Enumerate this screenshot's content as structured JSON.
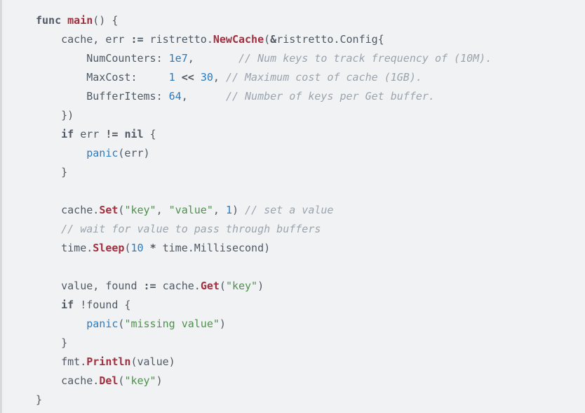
{
  "code": {
    "l1_func": "func",
    "l1_main": "main",
    "l1_rest": "() {",
    "l2a": "    cache, err ",
    "l2op": ":=",
    "l2b": " ristretto.",
    "l2fn": "NewCache",
    "l2c": "(",
    "l2amp": "&",
    "l2d": "ristretto.Config{",
    "l3a": "        NumCounters: ",
    "l3num": "1e7",
    "l3b": ",       ",
    "l3c": "// Num keys to track frequency of (10M).",
    "l4a": "        MaxCost:     ",
    "l4n1": "1",
    "l4sp1": " ",
    "l4op": "<<",
    "l4sp2": " ",
    "l4n2": "30",
    "l4b": ", ",
    "l4c": "// Maximum cost of cache (1GB).",
    "l5a": "        BufferItems: ",
    "l5num": "64",
    "l5b": ",      ",
    "l5c": "// Number of keys per Get buffer.",
    "l6": "    })",
    "l7a": "    ",
    "l7if": "if",
    "l7b": " err ",
    "l7op": "!=",
    "l7c": " ",
    "l7nil": "nil",
    "l7d": " {",
    "l8a": "        ",
    "l8panic": "panic",
    "l8b": "(err)",
    "l9": "    }",
    "l10": "",
    "l11a": "    cache.",
    "l11fn": "Set",
    "l11b": "(",
    "l11s1": "\"key\"",
    "l11c": ", ",
    "l11s2": "\"value\"",
    "l11d": ", ",
    "l11n": "1",
    "l11e": ") ",
    "l11cm": "// set a value",
    "l12a": "    ",
    "l12cm": "// wait for value to pass through buffers",
    "l13a": "    time.",
    "l13fn": "Sleep",
    "l13b": "(",
    "l13n": "10",
    "l13sp": " ",
    "l13op": "*",
    "l13c": " time.Millisecond)",
    "l14": "",
    "l15a": "    value, found ",
    "l15op": ":=",
    "l15b": " cache.",
    "l15fn": "Get",
    "l15c": "(",
    "l15s": "\"key\"",
    "l15d": ")",
    "l16a": "    ",
    "l16if": "if",
    "l16b": " !found {",
    "l17a": "        ",
    "l17panic": "panic",
    "l17b": "(",
    "l17s": "\"missing value\"",
    "l17c": ")",
    "l18": "    }",
    "l19a": "    fmt.",
    "l19fn": "Println",
    "l19b": "(value)",
    "l20a": "    cache.",
    "l20fn": "Del",
    "l20b": "(",
    "l20s": "\"key\"",
    "l20c": ")",
    "l21": "}"
  }
}
